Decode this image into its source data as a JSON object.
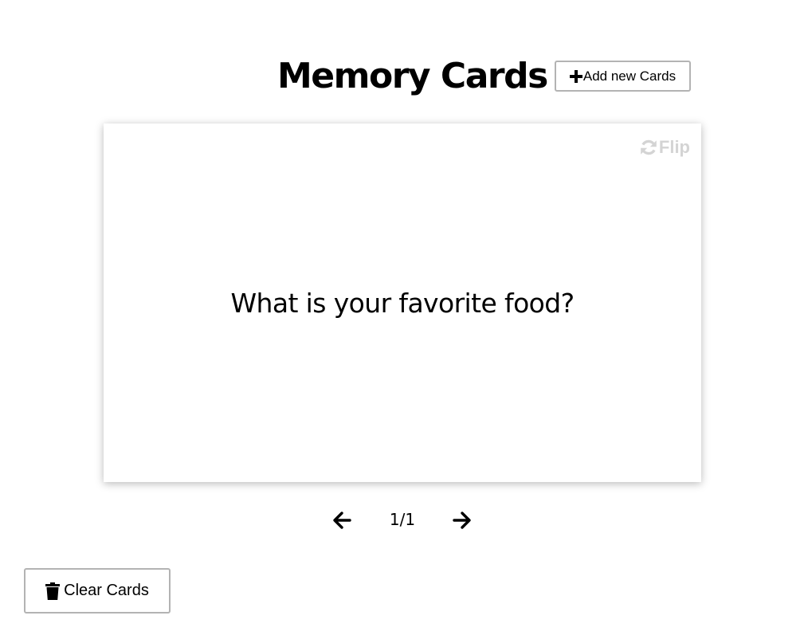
{
  "header": {
    "title": "Memory Cards",
    "add_button_label": "Add new Cards"
  },
  "card": {
    "question": "What is your favorite food?",
    "flip_label": "Flip"
  },
  "navigation": {
    "counter": "1/1"
  },
  "footer": {
    "clear_button_label": "Clear Cards"
  },
  "icons": {
    "add": "plus-icon",
    "flip": "refresh-icon",
    "prev": "arrow-left-icon",
    "next": "arrow-right-icon",
    "clear": "trash-icon"
  },
  "colors": {
    "flip_text": "#d4d4d4",
    "button_border": "#b3b3b3"
  }
}
